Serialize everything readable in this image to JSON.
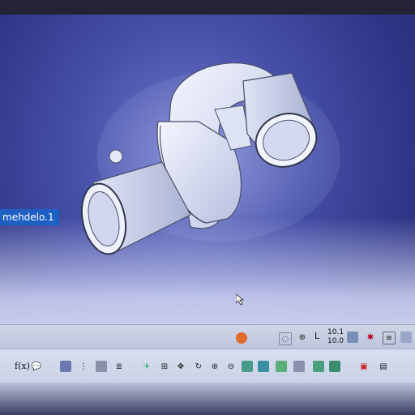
{
  "tree": {
    "node_label": "mehdelo.1"
  },
  "toolbar_upper": {
    "coordinate_readout_top": "10.1",
    "coordinate_readout_bottom": "10.0",
    "axis_label": "L",
    "icons": [
      "render-icon",
      "rotate-view-icon",
      "axis-icon",
      "measure-icon",
      "layers-icon",
      "hide-show-icon",
      "style-icon"
    ]
  },
  "toolbar_lower": {
    "formula_label": "f(x)",
    "icons": [
      "comment-icon",
      "table-icon",
      "chart-icon",
      "catalog-icon",
      "macro-icon",
      "fly-icon",
      "fit-all-icon",
      "pan-icon",
      "rotate-icon",
      "zoom-in-icon",
      "zoom-out-icon",
      "normal-view-icon",
      "iso-view-icon",
      "views-icon",
      "shading-icon",
      "hide-icon",
      "swap-icon",
      "camera-icon",
      "grid-icon"
    ]
  },
  "colors": {
    "background": "#2f3586",
    "part": "#e6ebfa",
    "tree_highlight": "#1e5fc4"
  }
}
